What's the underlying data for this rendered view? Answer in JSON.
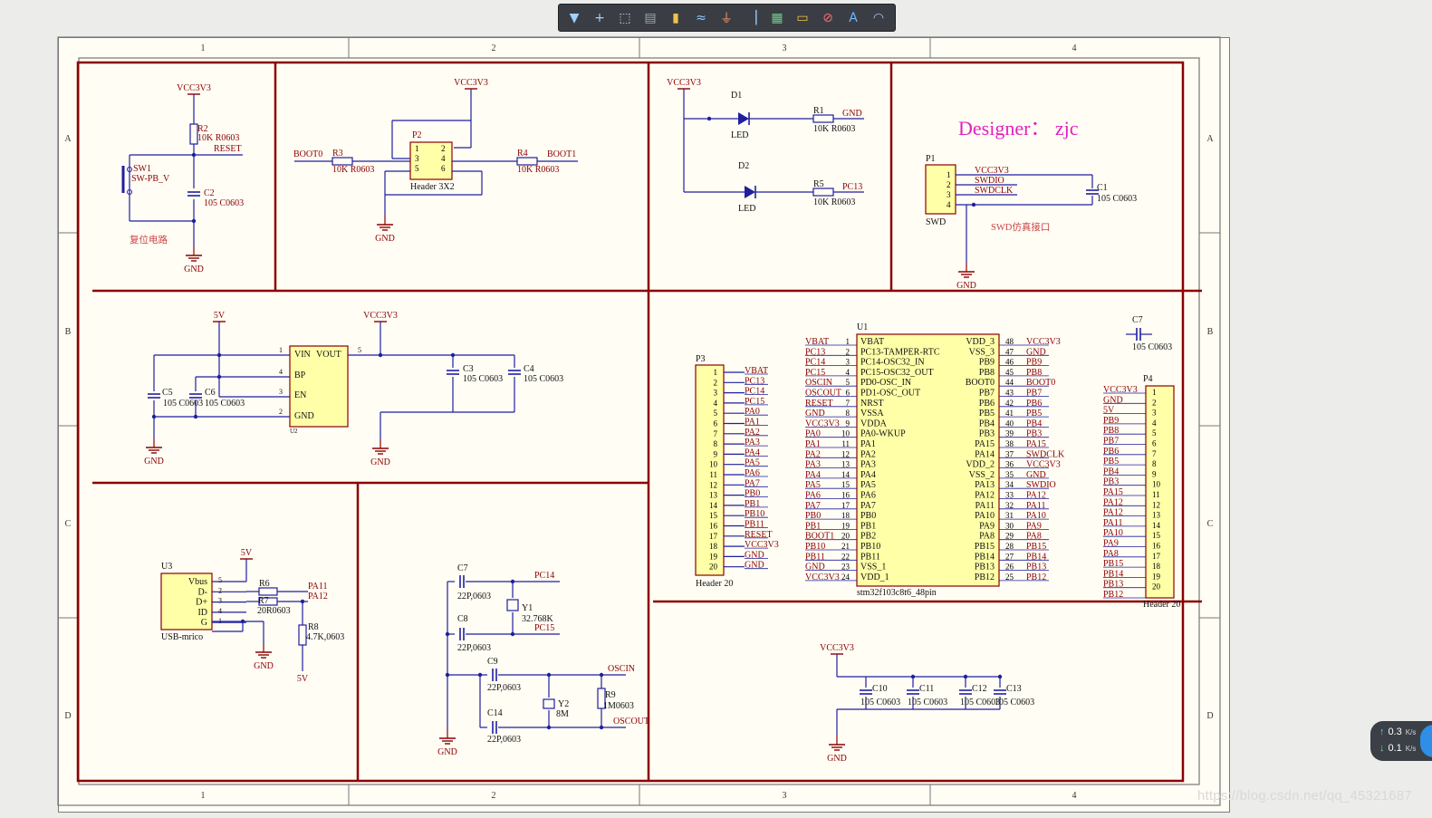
{
  "toolbar": {
    "tools": [
      {
        "name": "filter-tool",
        "glyph": "▼"
      },
      {
        "name": "wire-cross-tool",
        "glyph": "+"
      },
      {
        "name": "select-area-tool",
        "glyph": "⬚"
      },
      {
        "name": "align-tool",
        "glyph": "▤"
      },
      {
        "name": "place-part-tool",
        "glyph": "▮"
      },
      {
        "name": "bus-tool",
        "glyph": "≈"
      },
      {
        "name": "power-port-tool",
        "glyph": "⏚"
      },
      {
        "name": "sheet-entry-tool",
        "glyph": "▕"
      },
      {
        "name": "component-tool",
        "glyph": "▦"
      },
      {
        "name": "port-tool",
        "glyph": "▭"
      },
      {
        "name": "no-erc-tool",
        "glyph": "⊘"
      },
      {
        "name": "text-tool",
        "glyph": "A"
      },
      {
        "name": "arc-tool",
        "glyph": "◠"
      }
    ]
  },
  "sheet": {
    "zone_cols": [
      "1",
      "2",
      "3",
      "4"
    ],
    "zone_rows": [
      "A",
      "B",
      "C",
      "D"
    ],
    "designer": "Designer：  zjc"
  },
  "reset": {
    "vcc": "VCC3V3",
    "r_ref": "R2",
    "r_val": "10K R0603",
    "net": "RESET",
    "sw_ref": "SW1",
    "sw_val": "SW-PB_V",
    "c_ref": "C2",
    "c_val": "105 C0603",
    "gnd": "GND",
    "caption": "复位电路"
  },
  "boot": {
    "vcc": "VCC3V3",
    "p_ref": "P2",
    "p_val": "Header 3X2",
    "pins": [
      "1",
      "2",
      "3",
      "4",
      "5",
      "6"
    ],
    "r3_ref": "R3",
    "r3_val": "10K R0603",
    "r4_ref": "R4",
    "r4_val": "10K R0603",
    "boot0": "BOOT0",
    "boot1": "BOOT1",
    "gnd": "GND"
  },
  "led": {
    "vcc": "VCC3V3",
    "d1_ref": "D1",
    "d1_val": "LED",
    "d2_ref": "D2",
    "d2_val": "LED",
    "r1_ref": "R1",
    "r1_val": "10K R0603",
    "r5_ref": "R5",
    "r5_val": "10K R0603",
    "gnd": "GND",
    "pc13": "PC13"
  },
  "swd": {
    "p_ref": "P1",
    "p_val": "SWD",
    "pins": [
      "1",
      "2",
      "3",
      "4"
    ],
    "nets": [
      "VCC3V3",
      "SWDIO",
      "SWDCLK"
    ],
    "c_ref": "C1",
    "c_val": "105 C0603",
    "gnd": "GND",
    "caption": "SWD仿真接口"
  },
  "ldo": {
    "in_net": "5V",
    "out_net": "VCC3V3",
    "pins": {
      "vin": "VIN",
      "vout": "VOUT",
      "bp": "BP",
      "en": "EN",
      "gnd": "GND"
    },
    "pin_nums": [
      "1",
      "5",
      "4",
      "3",
      "2"
    ],
    "u_ref": "U2",
    "c5_ref": "C5",
    "c5_val": "105 C0603",
    "c6_ref": "C6",
    "c6_val": "105 C0603",
    "c3_ref": "C3",
    "c3_val": "105 C0603",
    "c4_ref": "C4",
    "c4_val": "105 C0603",
    "gnd": "GND"
  },
  "mcu": {
    "ref": "U1",
    "val": "stm32f103c8t6_48pin",
    "left": [
      {
        "net": "VBAT",
        "num": "1",
        "pin": "VBAT"
      },
      {
        "net": "PC13",
        "num": "2",
        "pin": "PC13-TAMPER-RTC"
      },
      {
        "net": "PC14",
        "num": "3",
        "pin": "PC14-OSC32_IN"
      },
      {
        "net": "PC15",
        "num": "4",
        "pin": "PC15-OSC32_OUT"
      },
      {
        "net": "OSCIN",
        "num": "5",
        "pin": "PD0-OSC_IN"
      },
      {
        "net": "OSCOUT",
        "num": "6",
        "pin": "PD1-OSC_OUT"
      },
      {
        "net": "RESET",
        "num": "7",
        "pin": "NRST"
      },
      {
        "net": "GND",
        "num": "8",
        "pin": "VSSA"
      },
      {
        "net": "VCC3V3",
        "num": "9",
        "pin": "VDDA"
      },
      {
        "net": "PA0",
        "num": "10",
        "pin": "PA0-WKUP"
      },
      {
        "net": "PA1",
        "num": "11",
        "pin": "PA1"
      },
      {
        "net": "PA2",
        "num": "12",
        "pin": "PA2"
      },
      {
        "net": "PA3",
        "num": "13",
        "pin": "PA3"
      },
      {
        "net": "PA4",
        "num": "14",
        "pin": "PA4"
      },
      {
        "net": "PA5",
        "num": "15",
        "pin": "PA5"
      },
      {
        "net": "PA6",
        "num": "16",
        "pin": "PA6"
      },
      {
        "net": "PA7",
        "num": "17",
        "pin": "PA7"
      },
      {
        "net": "PB0",
        "num": "18",
        "pin": "PB0"
      },
      {
        "net": "PB1",
        "num": "19",
        "pin": "PB1"
      },
      {
        "net": "BOOT1",
        "num": "20",
        "pin": "PB2"
      },
      {
        "net": "PB10",
        "num": "21",
        "pin": "PB10"
      },
      {
        "net": "PB11",
        "num": "22",
        "pin": "PB11"
      },
      {
        "net": "GND",
        "num": "23",
        "pin": "VSS_1"
      },
      {
        "net": "VCC3V3",
        "num": "24",
        "pin": "VDD_1"
      }
    ],
    "right": [
      {
        "pin": "VDD_3",
        "num": "48",
        "net": "VCC3V3"
      },
      {
        "pin": "VSS_3",
        "num": "47",
        "net": "GND"
      },
      {
        "pin": "PB9",
        "num": "46",
        "net": "PB9"
      },
      {
        "pin": "PB8",
        "num": "45",
        "net": "PB8"
      },
      {
        "pin": "BOOT0",
        "num": "44",
        "net": "BOOT0"
      },
      {
        "pin": "PB7",
        "num": "43",
        "net": "PB7"
      },
      {
        "pin": "PB6",
        "num": "42",
        "net": "PB6"
      },
      {
        "pin": "PB5",
        "num": "41",
        "net": "PB5"
      },
      {
        "pin": "PB4",
        "num": "40",
        "net": "PB4"
      },
      {
        "pin": "PB3",
        "num": "39",
        "net": "PB3"
      },
      {
        "pin": "PA15",
        "num": "38",
        "net": "PA15"
      },
      {
        "pin": "PA14",
        "num": "37",
        "net": "SWDCLK"
      },
      {
        "pin": "VDD_2",
        "num": "36",
        "net": "VCC3V3"
      },
      {
        "pin": "VSS_2",
        "num": "35",
        "net": "GND"
      },
      {
        "pin": "PA13",
        "num": "34",
        "net": "SWDIO"
      },
      {
        "pin": "PA12",
        "num": "33",
        "net": "PA12"
      },
      {
        "pin": "PA11",
        "num": "32",
        "net": "PA11"
      },
      {
        "pin": "PA10",
        "num": "31",
        "net": "PA10"
      },
      {
        "pin": "PA9",
        "num": "30",
        "net": "PA9"
      },
      {
        "pin": "PA8",
        "num": "29",
        "net": "PA8"
      },
      {
        "pin": "PB15",
        "num": "28",
        "net": "PB15"
      },
      {
        "pin": "PB14",
        "num": "27",
        "net": "PB14"
      },
      {
        "pin": "PB13",
        "num": "26",
        "net": "PB13"
      },
      {
        "pin": "PB12",
        "num": "25",
        "net": "PB12"
      }
    ],
    "c7_ref": "C7",
    "c7_val": "105 C0603"
  },
  "p3": {
    "ref": "P3",
    "val": "Header 20",
    "nets": [
      "VBAT",
      "PC13",
      "PC14",
      "PC15",
      "PA0",
      "PA1",
      "PA2",
      "PA3",
      "PA4",
      "PA5",
      "PA6",
      "PA7",
      "PB0",
      "PB1",
      "PB10",
      "PB11",
      "RESET",
      "VCC3V3",
      "GND",
      "GND"
    ]
  },
  "p4": {
    "ref": "P4",
    "val": "Header 20",
    "nets": [
      "VCC3V3",
      "GND",
      "5V",
      "PB9",
      "PB8",
      "PB7",
      "PB6",
      "PB5",
      "PB4",
      "PB3",
      "PA15",
      "PA12",
      "PA12",
      "PA11",
      "PA10",
      "PA9",
      "PA8",
      "PB15",
      "PB14",
      "PB13",
      "PB12"
    ]
  },
  "usb": {
    "ref": "U3",
    "val": "USB-mrico",
    "pins": [
      "Vbus",
      "D-",
      "D+",
      "ID",
      "G"
    ],
    "nums": [
      "5",
      "2",
      "3",
      "4",
      "1"
    ],
    "r6_ref": "R6",
    "r7_ref": "R7",
    "r7_val": "20R0603",
    "r6_val": "20R0603",
    "r8_ref": "R8",
    "r8_val": "4.7K,0603",
    "pa11": "PA11",
    "pa12": "PA12",
    "net5v": "5V",
    "gnd": "GND"
  },
  "osc": {
    "c7_ref": "C7",
    "c7_val": "22P,0603",
    "c8_ref": "C8",
    "c8_val": "22P,0603",
    "y1_ref": "Y1",
    "y1_val": "32.768K",
    "pc14": "PC14",
    "pc15": "PC15",
    "c9_ref": "C9",
    "c9_val": "22P,0603",
    "c14_ref": "C14",
    "c14_val": "22P,0603",
    "y2_ref": "Y2",
    "y2_val": "8M",
    "r9_ref": "R9",
    "r9_val": "1M0603",
    "oscin": "OSCIN",
    "oscout": "OSCOUT",
    "gnd": "GND"
  },
  "decoup": {
    "vcc": "VCC3V3",
    "caps": [
      {
        "ref": "C10",
        "val": "105 C0603"
      },
      {
        "ref": "C11",
        "val": "105 C0603"
      },
      {
        "ref": "C12",
        "val": "105 C0603"
      },
      {
        "ref": "C13",
        "val": "105 C0603"
      }
    ],
    "gnd": "GND"
  },
  "netspeed": {
    "up": "0.3",
    "down": "0.1",
    "unit": "K/s"
  },
  "watermark": "https://blog.csdn.net/qq_45321687",
  "colors": {
    "wire": "#1f1fa0",
    "frame": "#8b0000",
    "label": "#8b0000",
    "part": "#ffffa8",
    "designer": "#e020c0"
  }
}
